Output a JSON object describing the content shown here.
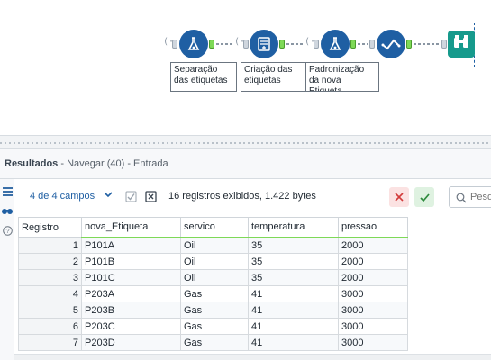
{
  "workflow": {
    "tools": [
      {
        "id": "t1",
        "label": "Separação das etiquetas",
        "icon": "flask-icon"
      },
      {
        "id": "t2",
        "label": "Criação das etiquetas",
        "icon": "formula-icon"
      },
      {
        "id": "t3",
        "label": "Padronização da nova Etiqueta",
        "icon": "flask-icon"
      },
      {
        "id": "t4",
        "label": "",
        "icon": "select-check-icon"
      },
      {
        "id": "t5",
        "label": "",
        "icon": "binoculars-icon"
      }
    ]
  },
  "results": {
    "title": "Resultados",
    "subtitle": " - Navegar (40) - Entrada",
    "fields_selector": "4 de 4 campos",
    "summary": "16 registros exibidos, 1.422 bytes",
    "search_placeholder": "Pesq"
  },
  "grid": {
    "columns": [
      "Registro",
      "nova_Etiqueta",
      "servico",
      "temperatura",
      "pressao"
    ],
    "rows": [
      [
        "1",
        "P101A",
        "Oil",
        "35",
        "2000"
      ],
      [
        "2",
        "P101B",
        "Oil",
        "35",
        "2000"
      ],
      [
        "3",
        "P101C",
        "Oil",
        "35",
        "2000"
      ],
      [
        "4",
        "P203A",
        "Gas",
        "41",
        "3000"
      ],
      [
        "5",
        "P203B",
        "Gas",
        "41",
        "3000"
      ],
      [
        "6",
        "P203C",
        "Gas",
        "41",
        "3000"
      ],
      [
        "7",
        "P203D",
        "Gas",
        "41",
        "3000"
      ]
    ]
  },
  "colors": {
    "tool_blue": "#1f5fa3",
    "browse_teal": "#169a8c",
    "anchor_green": "#7ed957",
    "cancel_red": "#d23b3b",
    "apply_green": "#2e8b3d"
  }
}
